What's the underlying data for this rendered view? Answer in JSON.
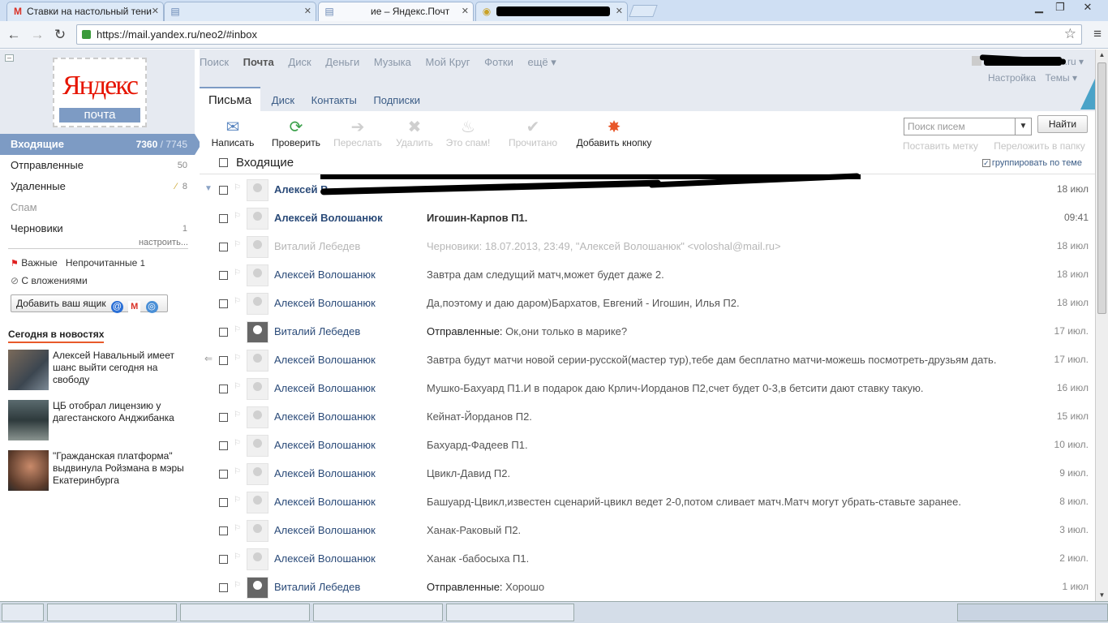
{
  "browser": {
    "tabs": [
      {
        "label": "Ставки на настольный тени",
        "icon": "gmail-icon"
      },
      {
        "label": "",
        "icon": "page-icon"
      },
      {
        "label": "ие – Яндекс.Почт",
        "icon": "page-icon"
      },
      {
        "label": "",
        "icon": "globe-icon"
      }
    ],
    "url": "https://mail.yandex.ru/neo2/#inbox"
  },
  "logo": {
    "text": "Яндекс",
    "sub": "почта"
  },
  "services": [
    "Поиск",
    "Почта",
    "Диск",
    "Деньги",
    "Музыка",
    "Мой Круг",
    "Фотки",
    "ещё ▾"
  ],
  "user_suffix": ".ru ▾",
  "settings_links": [
    "Настройка",
    "Темы ▾"
  ],
  "main_tabs": [
    "Письма",
    "Диск",
    "Контакты",
    "Подписки"
  ],
  "folders": [
    {
      "name": "Входящие",
      "unread": "7360",
      "total": "/ 7745"
    },
    {
      "name": "Отправленные",
      "count": "50"
    },
    {
      "name": "Удаленные",
      "count": "8"
    },
    {
      "name": "Спам",
      "count": ""
    },
    {
      "name": "Черновики",
      "count": "1"
    }
  ],
  "configure_link": "настроить...",
  "labels": {
    "important": "Важные",
    "unread": "Непрочитанные",
    "unread_count": "1",
    "attachments": "С вложениями"
  },
  "add_mailbox": "Добавить ваш ящик",
  "news": {
    "title": "Сегодня в новостях",
    "items": [
      {
        "text": "Алексей Навальный имеет шанс выйти сегодня на свободу"
      },
      {
        "text": "ЦБ отобрал лицензию у дагестанского Анджибанка"
      },
      {
        "text": "\"Гражданская платформа\" выдвинула Ройзмана в мэры Екатеринбурга"
      }
    ]
  },
  "toolbar": {
    "compose": "Написать",
    "check": "Проверить",
    "forward": "Переслать",
    "delete": "Удалить",
    "spam": "Это спам!",
    "read": "Прочитано",
    "add_button": "Добавить кнопку",
    "search_placeholder": "Поиск писем",
    "find": "Найти",
    "set_label": "Поставить метку",
    "move": "Переложить в папку"
  },
  "list": {
    "title": "Входящие",
    "group_by_thread": "группировать по теме",
    "messages": [
      {
        "from": "Алексей В",
        "subject": "",
        "date": "18 июл",
        "state": "unread"
      },
      {
        "from": "Алексей Волошанюк",
        "subject": "Игошин-Карпов П1.",
        "date": "09:41",
        "state": "unread"
      },
      {
        "from": "Виталий Лебедев",
        "subject": "Черновики: 18.07.2013, 23:49, \"Алексей Волошанюк\" <voloshal@mail.ru>",
        "date": "18 июл",
        "state": "draft"
      },
      {
        "from": "Алексей Волошанюк",
        "subject": "Завтра дам следущий матч,может будет даже 2.",
        "date": "18 июл",
        "state": "read"
      },
      {
        "from": "Алексей Волошанюк",
        "subject": "Да,поэтому и даю даром)Бархатов, Евгений - Игошин, Илья П2.",
        "date": "18 июл",
        "state": "read"
      },
      {
        "from": "Виталий Лебедев",
        "folder": "Отправленные:",
        "subject": "Ок,они только в марике?",
        "date": "17 июл.",
        "state": "read"
      },
      {
        "from": "Алексей Волошанюк",
        "subject": "Завтра будут матчи новой серии-русской(мастер тур),тебе дам бесплатно матчи-можешь посмотреть-друзьям дать.",
        "date": "17 июл.",
        "state": "read"
      },
      {
        "from": "Алексей Волошанюк",
        "subject": "Мушко-Бахуард П1.И в подарок даю Крлич-Иорданов П2,счет будет 0-3,в бетсити дают ставку такую.",
        "date": "16 июл",
        "state": "read"
      },
      {
        "from": "Алексей Волошанюк",
        "subject": "Кейнат-Йорданов П2.",
        "date": "15 июл",
        "state": "read"
      },
      {
        "from": "Алексей Волошанюк",
        "subject": "Бахуард-Фадеев П1.",
        "date": "10 июл.",
        "state": "read"
      },
      {
        "from": "Алексей Волошанюк",
        "subject": "Цвикл-Давид П2.",
        "date": "9 июл.",
        "state": "read"
      },
      {
        "from": "Алексей Волошанюк",
        "subject": "Башуард-Цвикл,известен сценарий-цвикл ведет 2-0,потом сливает матч.Матч могут убрать-ставьте заранее.",
        "date": "8 июл.",
        "state": "read"
      },
      {
        "from": "Алексей Волошанюк",
        "subject": "Ханак-Раковый П2.",
        "date": "3 июл.",
        "state": "read"
      },
      {
        "from": "Алексей Волошанюк",
        "subject": "Ханак -бабосыха П1.",
        "date": "2 июл.",
        "state": "read"
      },
      {
        "from": "Виталий Лебедев",
        "folder": "Отправленные:",
        "subject": "Хорошо",
        "date": "1 июл",
        "state": "read"
      }
    ]
  }
}
